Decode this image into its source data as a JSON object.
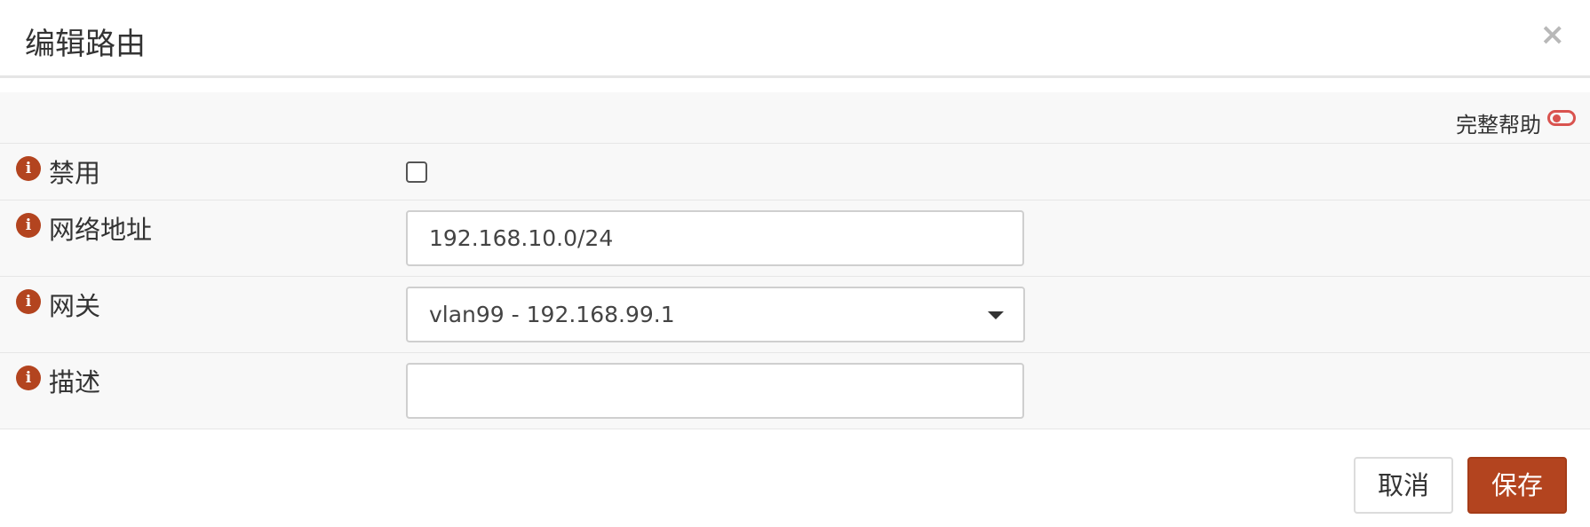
{
  "dialog": {
    "title": "编辑路由",
    "close_symbol": "×"
  },
  "help": {
    "label": "完整帮助",
    "toggle_state": "off",
    "toggle_color": "#d9534f"
  },
  "fields": {
    "disable": {
      "label": "禁用",
      "checked": false,
      "info_icon": "i"
    },
    "network": {
      "label": "网络地址",
      "value": "192.168.10.0/24",
      "info_icon": "i"
    },
    "gateway": {
      "label": "网关",
      "selected": "vlan99 - 192.168.99.1",
      "info_icon": "i"
    },
    "description": {
      "label": "描述",
      "value": "",
      "info_icon": "i"
    }
  },
  "buttons": {
    "cancel": "取消",
    "save": "保存"
  },
  "colors": {
    "accent": "#b3441f",
    "row_bg": "#f8f8f8",
    "border": "#e6e6e6"
  }
}
